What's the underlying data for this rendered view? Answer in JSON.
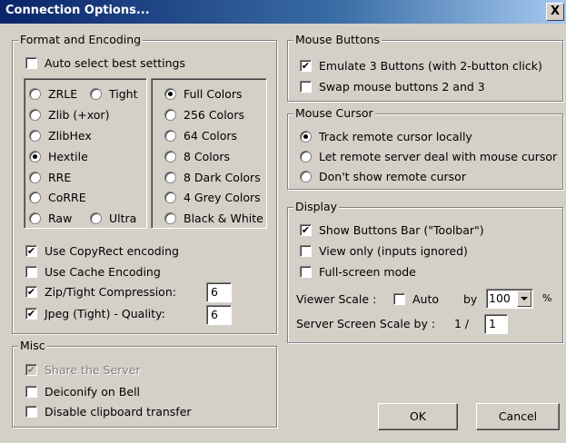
{
  "window": {
    "title": "Connection Options...",
    "close_glyph": "X"
  },
  "format_encoding": {
    "legend": "Format and Encoding",
    "auto_select": {
      "label": "Auto select best settings",
      "checked": false
    },
    "encodings": {
      "zrle": "ZRLE",
      "tight": "Tight",
      "zlib": "Zlib (+xor)",
      "zlibhex": "ZlibHex",
      "hextile": "Hextile",
      "rre": "RRE",
      "corre": "CoRRE",
      "raw": "Raw",
      "ultra": "Ultra",
      "selected": "Hextile"
    },
    "colors": {
      "full": "Full Colors",
      "c256": "256 Colors",
      "c64": "64 Colors",
      "c8": "8 Colors",
      "c8dark": "8 Dark Colors",
      "grey4": "4 Grey Colors",
      "bw": "Black & White",
      "selected": "Full Colors"
    },
    "copyrect": {
      "label": "Use CopyRect encoding",
      "checked": true
    },
    "cache": {
      "label": "Use Cache Encoding",
      "checked": false
    },
    "zip": {
      "label": "Zip/Tight Compression:",
      "checked": true,
      "value": "6"
    },
    "jpeg": {
      "label": "Jpeg (Tight) - Quality:",
      "checked": true,
      "value": "6"
    }
  },
  "misc": {
    "legend": "Misc",
    "share": {
      "label": "Share the Server",
      "checked": true,
      "disabled": true
    },
    "deiconify": {
      "label": "Deiconify on Bell",
      "checked": false
    },
    "clipboard": {
      "label": "Disable clipboard transfer",
      "checked": false
    }
  },
  "mouse_buttons": {
    "legend": "Mouse Buttons",
    "emulate3": {
      "label": "Emulate 3 Buttons (with 2-button click)",
      "checked": true
    },
    "swap": {
      "label": "Swap mouse buttons 2 and 3",
      "checked": false
    }
  },
  "mouse_cursor": {
    "legend": "Mouse Cursor",
    "track": "Track remote cursor locally",
    "remote": "Let remote server deal with mouse cursor",
    "dont": "Don't show remote cursor",
    "selected": "Track remote cursor locally"
  },
  "display": {
    "legend": "Display",
    "toolbar": {
      "label": "Show Buttons Bar (\"Toolbar\")",
      "checked": true
    },
    "viewonly": {
      "label": "View only (inputs ignored)",
      "checked": false
    },
    "fullscreen": {
      "label": "Full-screen mode",
      "checked": false
    },
    "viewer_scale_label": "Viewer Scale :",
    "auto": {
      "label": "Auto",
      "checked": false
    },
    "by_label": "by",
    "scale_value": "100",
    "percent": "%",
    "server_scale_label": "Server Screen Scale by :",
    "server_scale_prefix": "1 /",
    "server_scale_value": "1"
  },
  "buttons": {
    "ok": "OK",
    "cancel": "Cancel"
  },
  "check_glyph": "✔"
}
